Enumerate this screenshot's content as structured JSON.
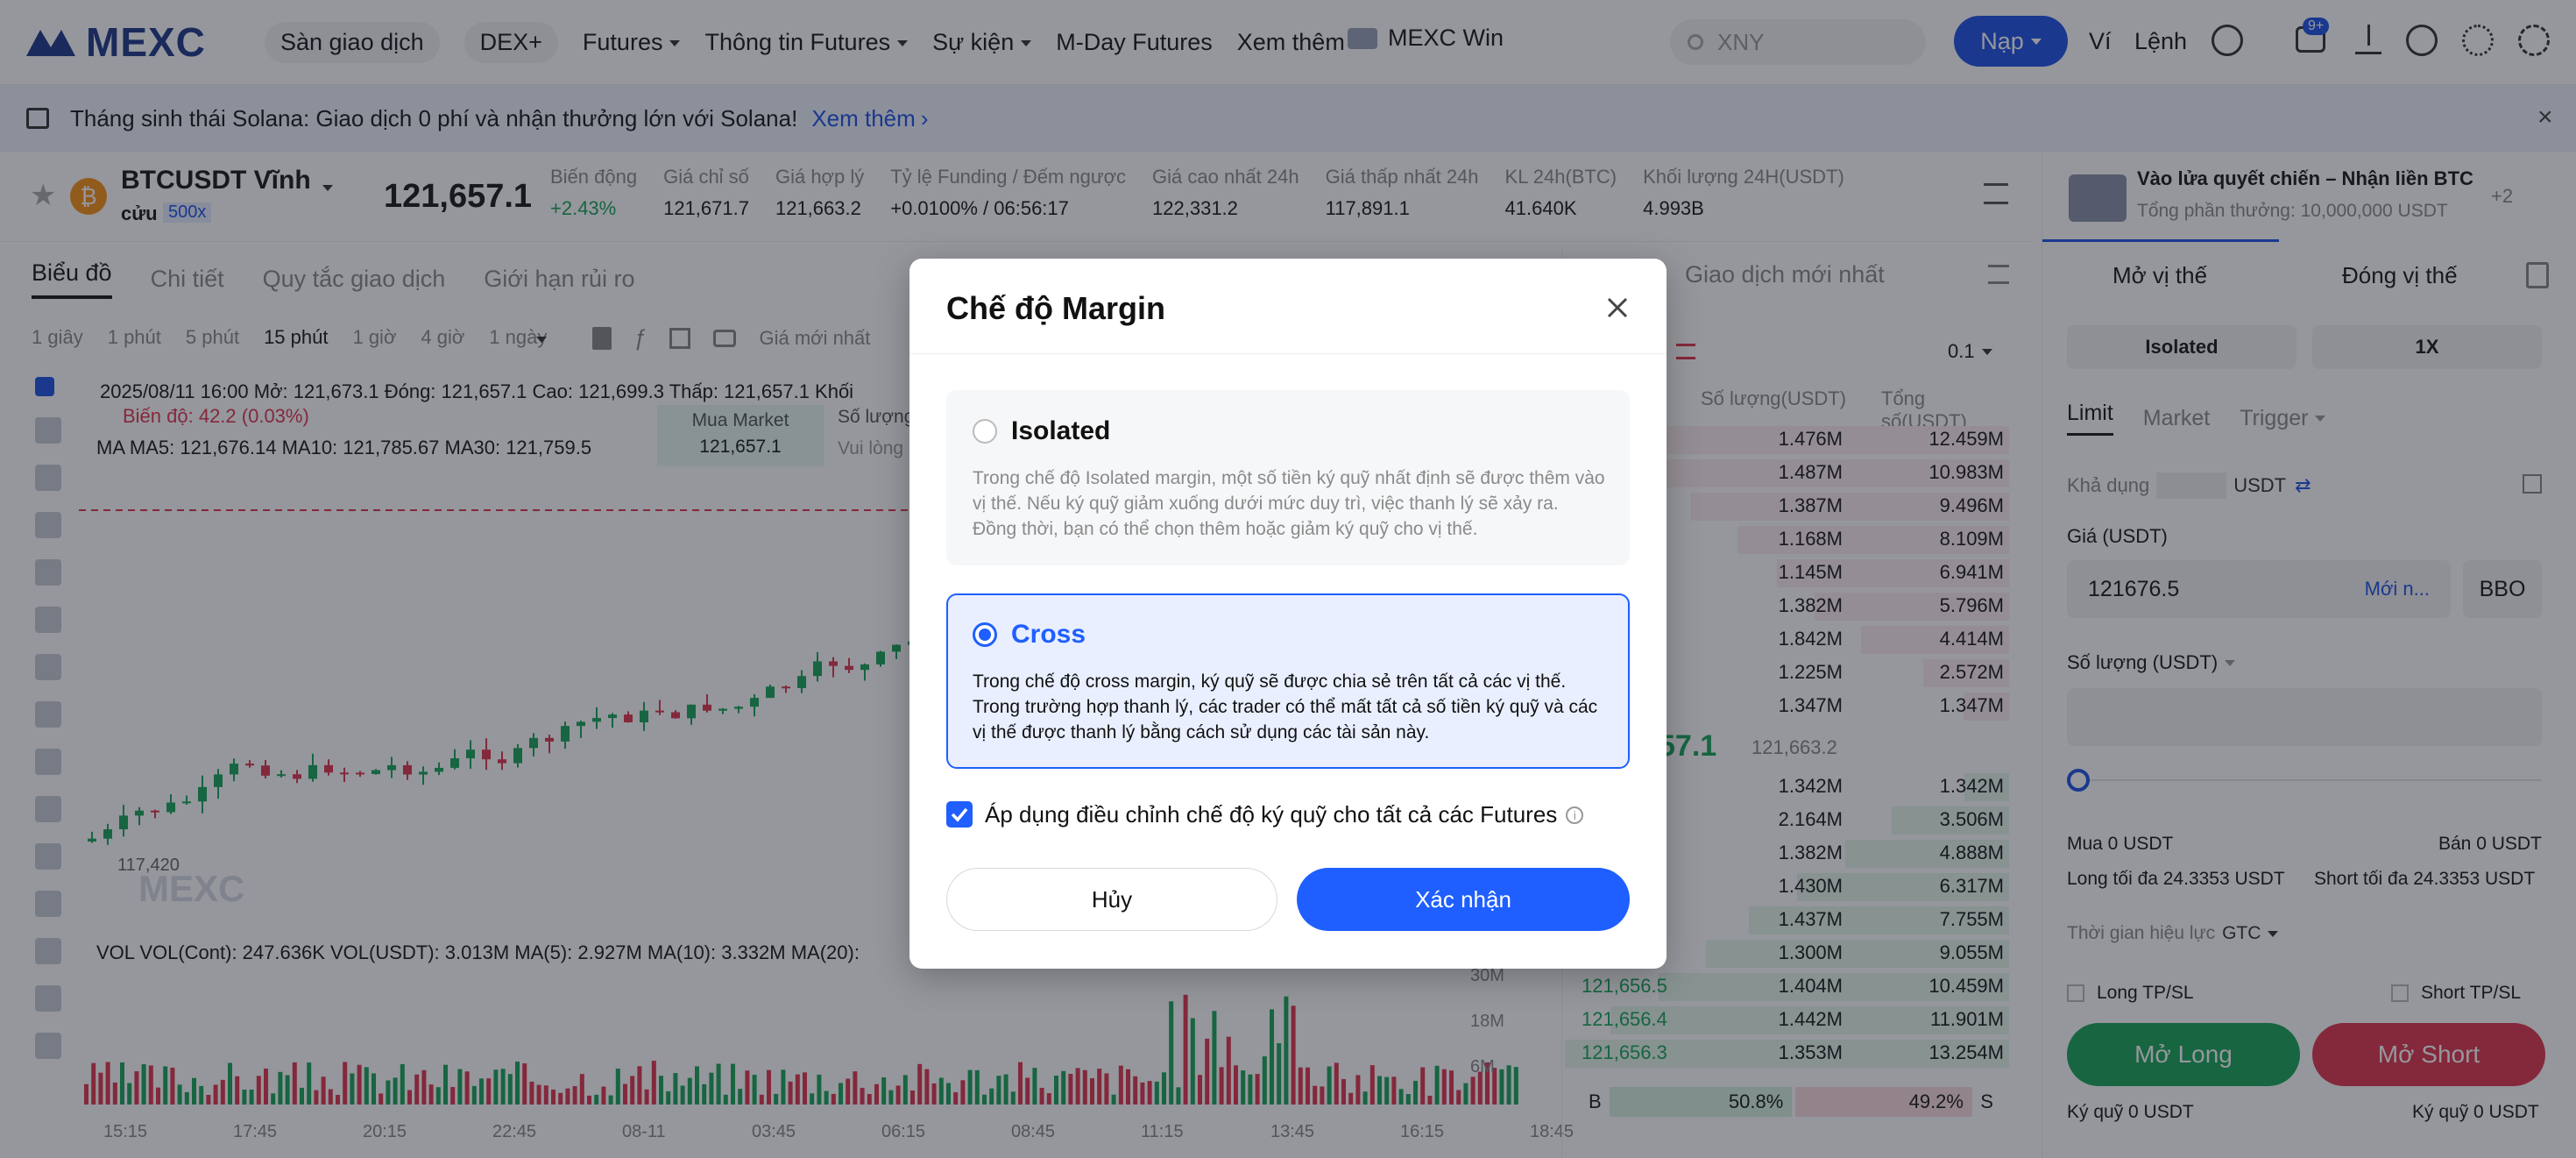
{
  "nav": {
    "logo": "MEXC",
    "items": [
      {
        "label": "Sàn giao dịch",
        "pill": true,
        "caret": false
      },
      {
        "label": "DEX+",
        "pill": true,
        "caret": false
      },
      {
        "label": "Futures",
        "pill": false,
        "caret": true
      },
      {
        "label": "Thông tin Futures",
        "pill": false,
        "caret": true
      },
      {
        "label": "Sự kiện",
        "pill": false,
        "caret": true
      },
      {
        "label": "M-Day Futures",
        "pill": false,
        "caret": false
      },
      {
        "label": "Xem thêm",
        "pill": false,
        "caret": true
      }
    ],
    "win_label": "MEXC Win",
    "search_placeholder": "XNY",
    "deposit_label": "Nạp",
    "wallet_label": "Ví",
    "orders_label": "Lệnh",
    "notif_badge": "9+"
  },
  "announcement": {
    "text": "Tháng sinh thái Solana: Giao dịch 0 phí và nhận thưởng lớn với Solana!",
    "link": "Xem thêm"
  },
  "ticker": {
    "symbol": "BTCUSDT Vĩnh",
    "symbol_sub": "cửu",
    "leverage": "500x",
    "price": "121,657.1",
    "stats": [
      {
        "label": "Biến động",
        "value": "+2.43%",
        "tone": "green"
      },
      {
        "label": "Giá chỉ số",
        "value": "121,671.7",
        "tone": ""
      },
      {
        "label": "Giá hợp lý",
        "value": "121,663.2",
        "tone": ""
      },
      {
        "label": "Tỷ lệ Funding / Đếm ngược",
        "value": "+0.0100%  /  06:56:17",
        "tone": ""
      },
      {
        "label": "Giá cao nhất 24h",
        "value": "122,331.2",
        "tone": ""
      },
      {
        "label": "Giá thấp nhất 24h",
        "value": "117,891.1",
        "tone": ""
      },
      {
        "label": "KL 24h(BTC)",
        "value": "41.640K",
        "tone": ""
      },
      {
        "label": "Khối lượng 24H(USDT)",
        "value": "4.993B",
        "tone": ""
      }
    ]
  },
  "chart_tabs": [
    "Biểu đồ",
    "Chi tiết",
    "Quy tắc giao dịch",
    "Giới hạn rủi ro"
  ],
  "intervals": [
    "1 giây",
    "1 phút",
    "5 phút",
    "15 phút",
    "1 giờ",
    "4 giờ",
    "1 ngày"
  ],
  "active_interval": "15 phút",
  "chart_info": {
    "date_line": "2025/08/11 16:00  Mở: 121,673.1  Đóng: 121,657.1  Cao: 121,699.3  Thấp: 121,657.1  Khối",
    "change_line": "Biến độ: 42.2 (0.03%)",
    "ma_line": "MA  MA5: 121,676.14  MA10: 121,785.67  MA30: 121,759.5",
    "vol_line": "VOL  VOL(Cont): 247.636K  VOL(USDT): 3.013M  MA(5): 2.927M  MA(10): 3.332M  MA(20):",
    "last_price_label": "Giá mới nhất",
    "low_marker": "117,420",
    "market_label": "Mua Market",
    "market_price": "121,657.1",
    "qty_label": "Số lượng",
    "qty_hint": "Vui lòng"
  },
  "time_axis": [
    "15:15",
    "17:45",
    "20:15",
    "22:45",
    "08-11",
    "03:45",
    "06:15",
    "08:45",
    "11:15",
    "13:45",
    "16:15",
    "18:45"
  ],
  "vol_axis": [
    "30M",
    "18M",
    "6M"
  ],
  "orderbook": {
    "tab_latest": "Giao dịch mới nhất",
    "precision": "0.1",
    "col_qty": "Số lượng(USDT)",
    "col_total": "Tổng số(USDT)",
    "asks": [
      {
        "qty": "1.476M",
        "total": "12.459M"
      },
      {
        "qty": "1.487M",
        "total": "10.983M"
      },
      {
        "qty": "1.387M",
        "total": "9.496M"
      },
      {
        "qty": "1.168M",
        "total": "8.109M"
      },
      {
        "qty": "1.145M",
        "total": "6.941M"
      },
      {
        "qty": "1.382M",
        "total": "5.796M"
      },
      {
        "qty": "1.842M",
        "total": "4.414M"
      },
      {
        "qty": "1.225M",
        "total": "2.572M"
      },
      {
        "qty": "1.347M",
        "total": "1.347M"
      }
    ],
    "mid_price": "57.1",
    "mid_index": "121,663.2",
    "bids": [
      {
        "price": "",
        "qty": "1.342M",
        "total": "1.342M"
      },
      {
        "price": "",
        "qty": "2.164M",
        "total": "3.506M"
      },
      {
        "price": "",
        "qty": "1.382M",
        "total": "4.888M"
      },
      {
        "price": "",
        "qty": "1.430M",
        "total": "6.317M"
      },
      {
        "price": "",
        "qty": "1.437M",
        "total": "7.755M"
      },
      {
        "price": "",
        "qty": "1.300M",
        "total": "9.055M"
      },
      {
        "price": "121,656.5",
        "qty": "1.404M",
        "total": "10.459M"
      },
      {
        "price": "121,656.4",
        "qty": "1.442M",
        "total": "11.901M"
      },
      {
        "price": "121,656.3",
        "qty": "1.353M",
        "total": "13.254M"
      }
    ],
    "buy_pct": "50.8%",
    "sell_pct": "49.2%",
    "buy_tag": "B",
    "sell_tag": "S"
  },
  "right_panel": {
    "promo_title": "Vào lửa quyết chiến – Nhận liền BTC",
    "promo_sub": "Tổng phần thưởng: 10,000,000 USDT",
    "promo_more": "+2",
    "open_tab": "Mở vị thế",
    "close_tab": "Đóng vị thế",
    "margin_mode": "Isolated",
    "leverage": "1X",
    "order_types": [
      "Limit",
      "Market",
      "Trigger"
    ],
    "available_label": "Khả dụng",
    "available_unit": "USDT",
    "price_label": "Giá (USDT)",
    "price_value": "121676.5",
    "price_newest": "Mới n...",
    "bbo": "BBO",
    "qty_label": "Số lượng (USDT)",
    "buy_label": "Mua 0 USDT",
    "sell_label": "Bán 0 USDT",
    "max_long": "Long tối đa 24.3353 USDT",
    "max_short": "Short tối đa 24.3353 USDT",
    "tif_label": "Thời gian hiệu lực",
    "tif_value": "GTC",
    "long_tpsl": "Long TP/SL",
    "short_tpsl": "Short TP/SL",
    "open_long": "Mở Long",
    "open_short": "Mở Short",
    "margin_left": "Ký quỹ 0 USDT",
    "margin_right": "Ký quỹ 0 USDT"
  },
  "modal": {
    "title": "Chế độ Margin",
    "isolated_title": "Isolated",
    "isolated_desc": "Trong chế độ Isolated margin, một số tiền ký quỹ nhất định sẽ được thêm vào vị thế. Nếu ký quỹ giảm xuống dưới mức duy trì, việc thanh lý sẽ xảy ra. Đồng thời, bạn có thể chọn thêm hoặc giảm ký quỹ cho vị thế.",
    "cross_title": "Cross",
    "cross_desc": "Trong chế độ cross margin, ký quỹ sẽ được chia sẻ trên tất cả các vị thế. Trong trường hợp thanh lý, các trader có thể mất tất cả số tiền ký quỹ và các vị thế được thanh lý bằng cách sử dụng các tài sản này.",
    "apply_all_label": "Áp dụng điều chỉnh chế độ ký quỹ cho tất cả các Futures",
    "cancel_label": "Hủy",
    "confirm_label": "Xác nhận",
    "selected": "Cross",
    "apply_all_checked": true
  },
  "colors": {
    "brand": "#1f3a8a",
    "primary": "#1f5fff",
    "up": "#1aa55a",
    "down": "#e0364f"
  }
}
